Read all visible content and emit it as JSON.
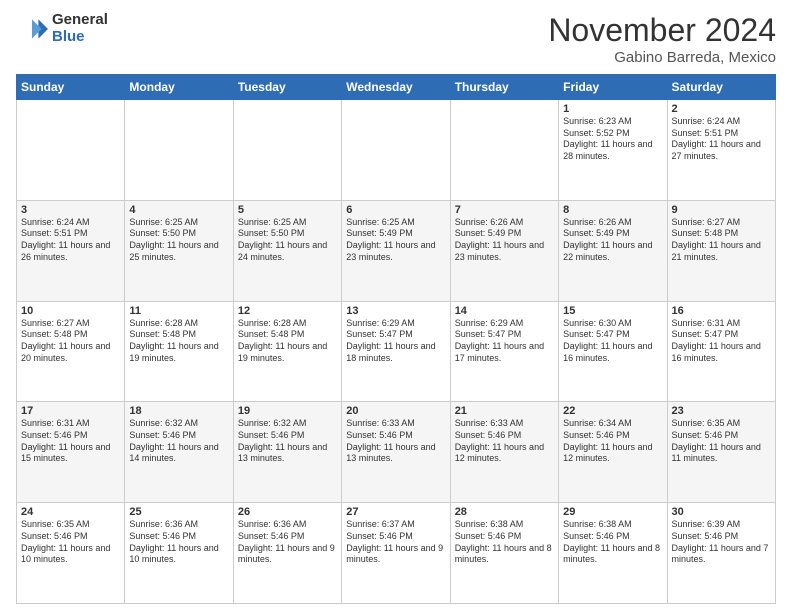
{
  "logo": {
    "general": "General",
    "blue": "Blue"
  },
  "title": {
    "month": "November 2024",
    "location": "Gabino Barreda, Mexico"
  },
  "days_of_week": [
    "Sunday",
    "Monday",
    "Tuesday",
    "Wednesday",
    "Thursday",
    "Friday",
    "Saturday"
  ],
  "weeks": [
    [
      {
        "day": "",
        "info": ""
      },
      {
        "day": "",
        "info": ""
      },
      {
        "day": "",
        "info": ""
      },
      {
        "day": "",
        "info": ""
      },
      {
        "day": "",
        "info": ""
      },
      {
        "day": "1",
        "info": "Sunrise: 6:23 AM\nSunset: 5:52 PM\nDaylight: 11 hours and 28 minutes."
      },
      {
        "day": "2",
        "info": "Sunrise: 6:24 AM\nSunset: 5:51 PM\nDaylight: 11 hours and 27 minutes."
      }
    ],
    [
      {
        "day": "3",
        "info": "Sunrise: 6:24 AM\nSunset: 5:51 PM\nDaylight: 11 hours and 26 minutes."
      },
      {
        "day": "4",
        "info": "Sunrise: 6:25 AM\nSunset: 5:50 PM\nDaylight: 11 hours and 25 minutes."
      },
      {
        "day": "5",
        "info": "Sunrise: 6:25 AM\nSunset: 5:50 PM\nDaylight: 11 hours and 24 minutes."
      },
      {
        "day": "6",
        "info": "Sunrise: 6:25 AM\nSunset: 5:49 PM\nDaylight: 11 hours and 23 minutes."
      },
      {
        "day": "7",
        "info": "Sunrise: 6:26 AM\nSunset: 5:49 PM\nDaylight: 11 hours and 23 minutes."
      },
      {
        "day": "8",
        "info": "Sunrise: 6:26 AM\nSunset: 5:49 PM\nDaylight: 11 hours and 22 minutes."
      },
      {
        "day": "9",
        "info": "Sunrise: 6:27 AM\nSunset: 5:48 PM\nDaylight: 11 hours and 21 minutes."
      }
    ],
    [
      {
        "day": "10",
        "info": "Sunrise: 6:27 AM\nSunset: 5:48 PM\nDaylight: 11 hours and 20 minutes."
      },
      {
        "day": "11",
        "info": "Sunrise: 6:28 AM\nSunset: 5:48 PM\nDaylight: 11 hours and 19 minutes."
      },
      {
        "day": "12",
        "info": "Sunrise: 6:28 AM\nSunset: 5:48 PM\nDaylight: 11 hours and 19 minutes."
      },
      {
        "day": "13",
        "info": "Sunrise: 6:29 AM\nSunset: 5:47 PM\nDaylight: 11 hours and 18 minutes."
      },
      {
        "day": "14",
        "info": "Sunrise: 6:29 AM\nSunset: 5:47 PM\nDaylight: 11 hours and 17 minutes."
      },
      {
        "day": "15",
        "info": "Sunrise: 6:30 AM\nSunset: 5:47 PM\nDaylight: 11 hours and 16 minutes."
      },
      {
        "day": "16",
        "info": "Sunrise: 6:31 AM\nSunset: 5:47 PM\nDaylight: 11 hours and 16 minutes."
      }
    ],
    [
      {
        "day": "17",
        "info": "Sunrise: 6:31 AM\nSunset: 5:46 PM\nDaylight: 11 hours and 15 minutes."
      },
      {
        "day": "18",
        "info": "Sunrise: 6:32 AM\nSunset: 5:46 PM\nDaylight: 11 hours and 14 minutes."
      },
      {
        "day": "19",
        "info": "Sunrise: 6:32 AM\nSunset: 5:46 PM\nDaylight: 11 hours and 13 minutes."
      },
      {
        "day": "20",
        "info": "Sunrise: 6:33 AM\nSunset: 5:46 PM\nDaylight: 11 hours and 13 minutes."
      },
      {
        "day": "21",
        "info": "Sunrise: 6:33 AM\nSunset: 5:46 PM\nDaylight: 11 hours and 12 minutes."
      },
      {
        "day": "22",
        "info": "Sunrise: 6:34 AM\nSunset: 5:46 PM\nDaylight: 11 hours and 12 minutes."
      },
      {
        "day": "23",
        "info": "Sunrise: 6:35 AM\nSunset: 5:46 PM\nDaylight: 11 hours and 11 minutes."
      }
    ],
    [
      {
        "day": "24",
        "info": "Sunrise: 6:35 AM\nSunset: 5:46 PM\nDaylight: 11 hours and 10 minutes."
      },
      {
        "day": "25",
        "info": "Sunrise: 6:36 AM\nSunset: 5:46 PM\nDaylight: 11 hours and 10 minutes."
      },
      {
        "day": "26",
        "info": "Sunrise: 6:36 AM\nSunset: 5:46 PM\nDaylight: 11 hours and 9 minutes."
      },
      {
        "day": "27",
        "info": "Sunrise: 6:37 AM\nSunset: 5:46 PM\nDaylight: 11 hours and 9 minutes."
      },
      {
        "day": "28",
        "info": "Sunrise: 6:38 AM\nSunset: 5:46 PM\nDaylight: 11 hours and 8 minutes."
      },
      {
        "day": "29",
        "info": "Sunrise: 6:38 AM\nSunset: 5:46 PM\nDaylight: 11 hours and 8 minutes."
      },
      {
        "day": "30",
        "info": "Sunrise: 6:39 AM\nSunset: 5:46 PM\nDaylight: 11 hours and 7 minutes."
      }
    ]
  ]
}
